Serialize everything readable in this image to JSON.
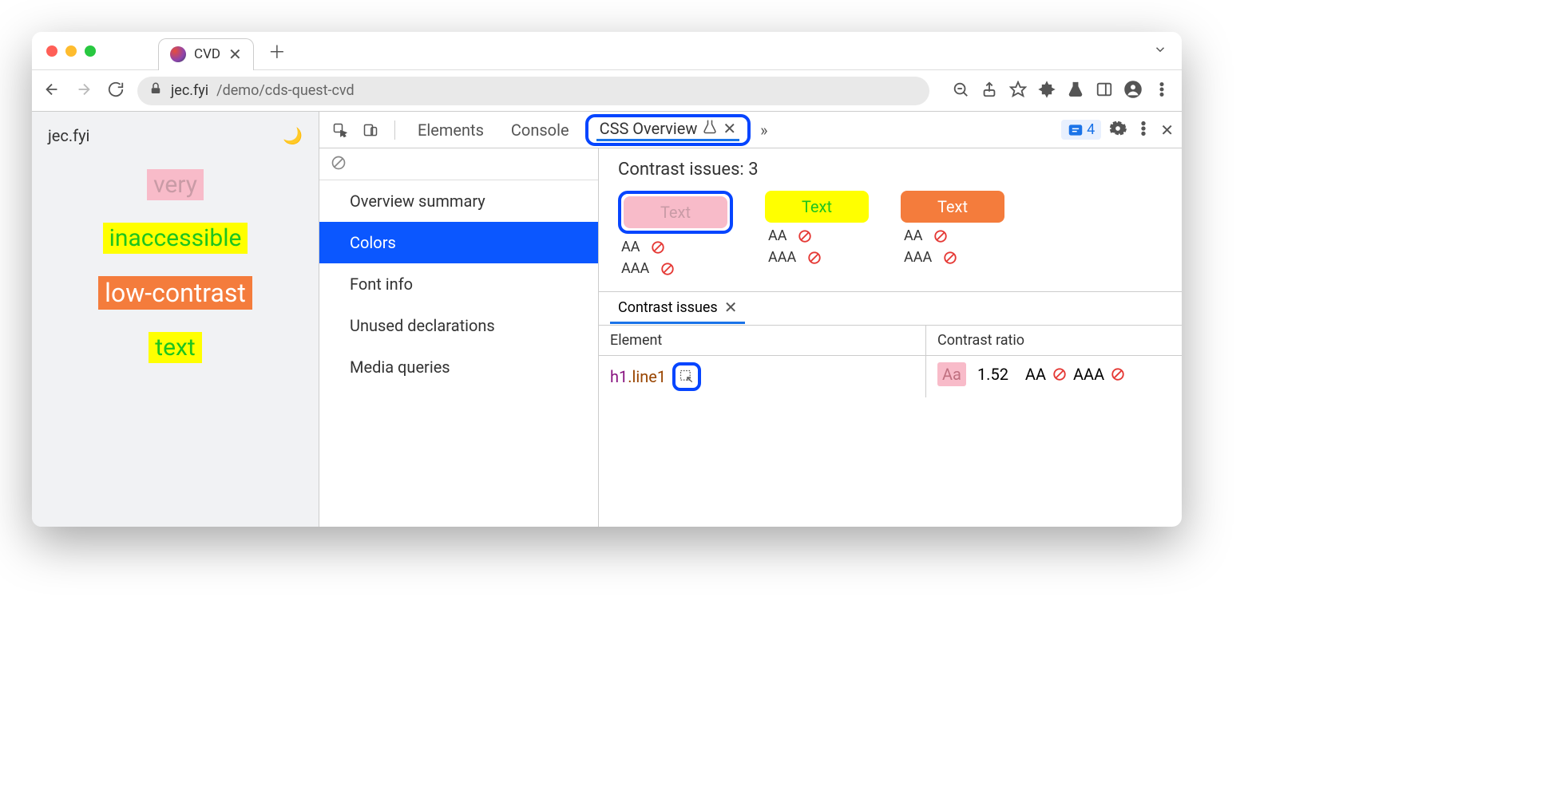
{
  "browser": {
    "tab_title": "CVD",
    "url_host": "jec.fyi",
    "url_path": "/demo/cds-quest-cvd"
  },
  "page": {
    "site_name": "jec.fyi",
    "lines": [
      "very",
      "inaccessible",
      "low-contrast",
      "text"
    ]
  },
  "devtools": {
    "tabs": {
      "elements": "Elements",
      "console": "Console",
      "css_overview": "CSS Overview",
      "more_indicator": "»"
    },
    "issues_count": "4",
    "sidebar": {
      "overview_summary": "Overview summary",
      "colors": "Colors",
      "font_info": "Font info",
      "unused": "Unused declarations",
      "media": "Media queries"
    },
    "contrast": {
      "heading_label": "Contrast issues:",
      "heading_count": "3",
      "swatch_label": "Text",
      "aa": "AA",
      "aaa": "AAA"
    },
    "issues_panel": {
      "tab_label": "Contrast issues",
      "col_element": "Element",
      "col_ratio": "Contrast ratio",
      "row": {
        "tag": "h1",
        "class": ".line1",
        "aa_chip": "Aa",
        "ratio": "1.52",
        "aa": "AA",
        "aaa": "AAA"
      }
    }
  }
}
